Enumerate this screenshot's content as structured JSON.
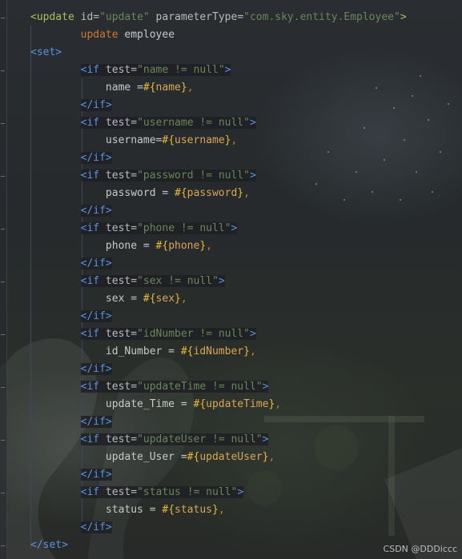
{
  "editor": {
    "lines": [
      [
        {
          "t": "<update",
          "c": "green-tag"
        },
        {
          "t": " id",
          "c": "attr"
        },
        {
          "t": "=",
          "c": "attr"
        },
        {
          "t": "\"update\"",
          "c": "str"
        },
        {
          "t": " parameterType",
          "c": "attr"
        },
        {
          "t": "=",
          "c": "attr"
        },
        {
          "t": "\"com.sky.entity.Employee\"",
          "c": "str"
        },
        {
          "t": ">",
          "c": "green-tag"
        }
      ],
      [
        {
          "t": "        update",
          "c": "kw"
        },
        {
          "t": " employee",
          "c": "plain"
        }
      ],
      [
        {
          "t": "<set>",
          "c": "blue-tag"
        }
      ],
      [
        {
          "t": "        ",
          "c": "plain"
        },
        {
          "t": "<if",
          "c": "blue-tag",
          "h": true
        },
        {
          "t": " test",
          "c": "attr",
          "h": true
        },
        {
          "t": "=",
          "c": "attr",
          "h": true
        },
        {
          "t": "\"name != null\"",
          "c": "str",
          "h": true
        },
        {
          "t": ">",
          "c": "blue-tag",
          "h": true
        }
      ],
      [
        {
          "t": "            name =",
          "c": "plain"
        },
        {
          "t": "#{",
          "c": "brace"
        },
        {
          "t": "name",
          "c": "var"
        },
        {
          "t": "}",
          "c": "brace"
        },
        {
          "t": ",",
          "c": "kw"
        }
      ],
      [
        {
          "t": "        ",
          "c": "plain"
        },
        {
          "t": "</if>",
          "c": "blue-tag",
          "h": true
        }
      ],
      [
        {
          "t": "        ",
          "c": "plain"
        },
        {
          "t": "<if",
          "c": "blue-tag",
          "h": true
        },
        {
          "t": " test",
          "c": "attr",
          "h": true
        },
        {
          "t": "=",
          "c": "attr",
          "h": true
        },
        {
          "t": "\"username != null\"",
          "c": "str",
          "h": true
        },
        {
          "t": ">",
          "c": "blue-tag",
          "h": true
        }
      ],
      [
        {
          "t": "            username=",
          "c": "plain"
        },
        {
          "t": "#{",
          "c": "brace"
        },
        {
          "t": "username",
          "c": "var"
        },
        {
          "t": "}",
          "c": "brace"
        },
        {
          "t": ",",
          "c": "kw"
        }
      ],
      [
        {
          "t": "        ",
          "c": "plain"
        },
        {
          "t": "</if>",
          "c": "blue-tag",
          "h": true
        }
      ],
      [
        {
          "t": "        ",
          "c": "plain"
        },
        {
          "t": "<if",
          "c": "blue-tag",
          "h": true
        },
        {
          "t": " test",
          "c": "attr",
          "h": true
        },
        {
          "t": "=",
          "c": "attr",
          "h": true
        },
        {
          "t": "\"password != null\"",
          "c": "str",
          "h": true
        },
        {
          "t": ">",
          "c": "blue-tag",
          "h": true
        }
      ],
      [
        {
          "t": "            password = ",
          "c": "plain"
        },
        {
          "t": "#{",
          "c": "brace"
        },
        {
          "t": "password",
          "c": "var"
        },
        {
          "t": "}",
          "c": "brace"
        },
        {
          "t": ",",
          "c": "kw"
        }
      ],
      [
        {
          "t": "        ",
          "c": "plain"
        },
        {
          "t": "</if>",
          "c": "blue-tag",
          "h": true
        }
      ],
      [
        {
          "t": "        ",
          "c": "plain"
        },
        {
          "t": "<if",
          "c": "blue-tag",
          "h": true
        },
        {
          "t": " test",
          "c": "attr",
          "h": true
        },
        {
          "t": "=",
          "c": "attr",
          "h": true
        },
        {
          "t": "\"phone != null\"",
          "c": "str",
          "h": true
        },
        {
          "t": ">",
          "c": "blue-tag",
          "h": true
        }
      ],
      [
        {
          "t": "            phone = ",
          "c": "plain"
        },
        {
          "t": "#{",
          "c": "brace"
        },
        {
          "t": "phone",
          "c": "var"
        },
        {
          "t": "}",
          "c": "brace"
        },
        {
          "t": ",",
          "c": "kw"
        }
      ],
      [
        {
          "t": "        ",
          "c": "plain"
        },
        {
          "t": "</if>",
          "c": "blue-tag",
          "h": true
        }
      ],
      [
        {
          "t": "        ",
          "c": "plain"
        },
        {
          "t": "<if",
          "c": "blue-tag",
          "h": true
        },
        {
          "t": " test",
          "c": "attr",
          "h": true
        },
        {
          "t": "=",
          "c": "attr",
          "h": true
        },
        {
          "t": "\"sex != null\"",
          "c": "str",
          "h": true
        },
        {
          "t": ">",
          "c": "blue-tag",
          "h": true
        }
      ],
      [
        {
          "t": "            sex = ",
          "c": "plain"
        },
        {
          "t": "#{",
          "c": "brace"
        },
        {
          "t": "sex",
          "c": "var"
        },
        {
          "t": "}",
          "c": "brace"
        },
        {
          "t": ",",
          "c": "kw"
        }
      ],
      [
        {
          "t": "        ",
          "c": "plain"
        },
        {
          "t": "</if>",
          "c": "blue-tag",
          "h": true
        }
      ],
      [
        {
          "t": "        ",
          "c": "plain"
        },
        {
          "t": "<if",
          "c": "blue-tag",
          "h": true
        },
        {
          "t": " test",
          "c": "attr",
          "h": true
        },
        {
          "t": "=",
          "c": "attr",
          "h": true
        },
        {
          "t": "\"idNumber != null\"",
          "c": "str",
          "h": true
        },
        {
          "t": ">",
          "c": "blue-tag",
          "h": true
        }
      ],
      [
        {
          "t": "            id_Number = ",
          "c": "plain"
        },
        {
          "t": "#{",
          "c": "brace"
        },
        {
          "t": "idNumber",
          "c": "var"
        },
        {
          "t": "}",
          "c": "brace"
        },
        {
          "t": ",",
          "c": "kw"
        }
      ],
      [
        {
          "t": "        ",
          "c": "plain"
        },
        {
          "t": "</if>",
          "c": "blue-tag",
          "h": true
        }
      ],
      [
        {
          "t": "        ",
          "c": "plain"
        },
        {
          "t": "<if",
          "c": "blue-tag",
          "h": true
        },
        {
          "t": " test",
          "c": "attr",
          "h": true
        },
        {
          "t": "=",
          "c": "attr",
          "h": true
        },
        {
          "t": "\"updateTime != null\"",
          "c": "str",
          "h": true
        },
        {
          "t": ">",
          "c": "blue-tag",
          "h": true
        }
      ],
      [
        {
          "t": "            update_Time = ",
          "c": "plain"
        },
        {
          "t": "#{",
          "c": "brace"
        },
        {
          "t": "updateTime",
          "c": "var"
        },
        {
          "t": "}",
          "c": "brace"
        },
        {
          "t": ",",
          "c": "kw"
        }
      ],
      [
        {
          "t": "        ",
          "c": "plain"
        },
        {
          "t": "</if>",
          "c": "blue-tag",
          "h": true
        }
      ],
      [
        {
          "t": "        ",
          "c": "plain"
        },
        {
          "t": "<if",
          "c": "blue-tag",
          "h": true
        },
        {
          "t": " test",
          "c": "attr",
          "h": true
        },
        {
          "t": "=",
          "c": "attr",
          "h": true
        },
        {
          "t": "\"updateUser != null\"",
          "c": "str",
          "h": true
        },
        {
          "t": ">",
          "c": "blue-tag",
          "h": true
        }
      ],
      [
        {
          "t": "            update_User =",
          "c": "plain"
        },
        {
          "t": "#{",
          "c": "brace"
        },
        {
          "t": "updateUser",
          "c": "var"
        },
        {
          "t": "}",
          "c": "brace"
        },
        {
          "t": ",",
          "c": "kw"
        }
      ],
      [
        {
          "t": "        ",
          "c": "plain"
        },
        {
          "t": "</if>",
          "c": "blue-tag",
          "h": true
        }
      ],
      [
        {
          "t": "        ",
          "c": "plain"
        },
        {
          "t": "<if",
          "c": "blue-tag",
          "h": true
        },
        {
          "t": " test",
          "c": "attr",
          "h": true
        },
        {
          "t": "=",
          "c": "attr",
          "h": true
        },
        {
          "t": "\"status != null\"",
          "c": "str",
          "h": true
        },
        {
          "t": ">",
          "c": "blue-tag",
          "h": true
        }
      ],
      [
        {
          "t": "            status = ",
          "c": "plain"
        },
        {
          "t": "#{",
          "c": "brace"
        },
        {
          "t": "status",
          "c": "var"
        },
        {
          "t": "}",
          "c": "brace"
        },
        {
          "t": ",",
          "c": "kw"
        }
      ],
      [
        {
          "t": "        ",
          "c": "plain"
        },
        {
          "t": "</if>",
          "c": "blue-tag",
          "h": true
        }
      ],
      [
        {
          "t": "</set>",
          "c": "blue-tag"
        }
      ]
    ]
  },
  "watermark": "CSDN @DDDiccc"
}
